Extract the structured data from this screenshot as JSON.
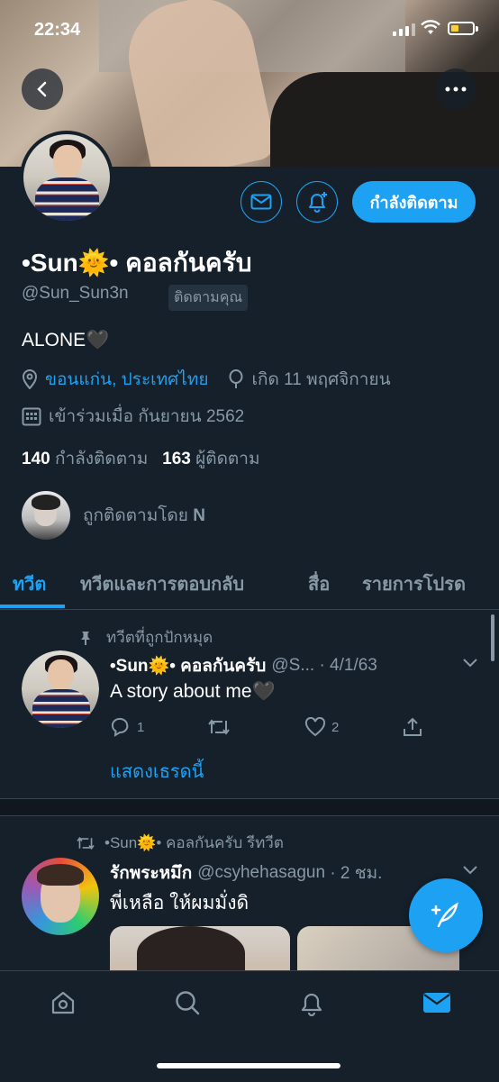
{
  "status_bar": {
    "time": "22:34"
  },
  "profile": {
    "name": "•Sun🌞• คอลกันครับ",
    "handle": "@Sun_Sun3n",
    "follows_you": "ติดตามคุณ",
    "bio": "ALONE🖤",
    "location": "ขอนแก่น, ประเทศไทย",
    "birthday": "เกิด 11 พฤศจิกายน",
    "joined": "เข้าร่วมเมื่อ กันยายน 2562",
    "following_count": "140",
    "following_label": "กำลังติดตาม",
    "followers_count": "163",
    "followers_label": "ผู้ติดตาม",
    "followed_by": "ถูกติดตามโดย",
    "followed_by_name": "N",
    "follow_button": "กำลังติดตาม"
  },
  "tabs": [
    "ทวีต",
    "ทวีตและการตอบกลับ",
    "สื่อ",
    "รายการโปรด"
  ],
  "tweets": [
    {
      "context": "ทวีตที่ถูกปักหมุด",
      "name": "•Sun🌞• คอลกันครับ",
      "handle": "@S...",
      "date": "· 4/1/63",
      "text": "A story about me🖤",
      "replies": "1",
      "retweets": "",
      "likes": "2",
      "show_thread": "แสดงเธรดนี้"
    },
    {
      "context": "•Sun🌞• คอลกันครับ รีทวีต",
      "name": "รักพระหมึก",
      "handle": "@csyhehasagun",
      "date": "· 2 ชม.",
      "text": "พี่เหลือ ให้ผมมั่งดิ"
    }
  ],
  "colors": {
    "accent": "#1da1f2",
    "background": "#15202b",
    "muted": "#8899a6"
  },
  "icons": [
    "back-arrow-icon",
    "more-icon",
    "mail-icon",
    "bell-plus-icon",
    "location-icon",
    "balloon-icon",
    "calendar-icon",
    "pin-icon",
    "retweet-icon",
    "reply-icon",
    "like-icon",
    "share-icon",
    "chevron-down-icon",
    "compose-icon",
    "home-icon",
    "search-icon",
    "notifications-icon",
    "messages-icon"
  ]
}
